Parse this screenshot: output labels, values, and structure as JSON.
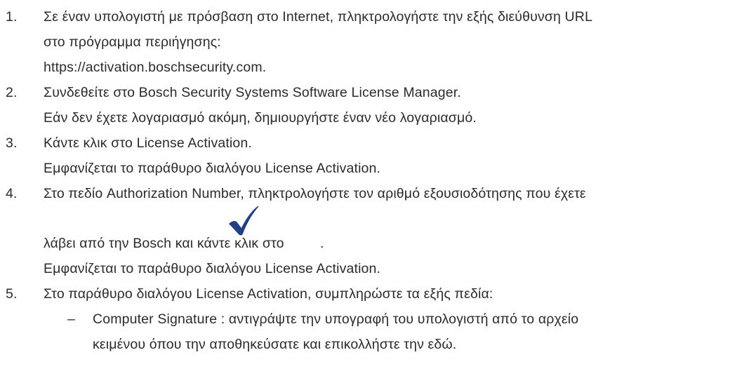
{
  "steps": [
    {
      "number": "1.",
      "lines": [
        "Σε έναν υπολογιστή με πρόσβαση στο Internet, πληκτρολογήστε την εξής διεύθυνση URL",
        "στο πρόγραμμα περιήγησης:",
        "https://activation.boschsecurity.com."
      ]
    },
    {
      "number": "2.",
      "lines": [
        "Συνδεθείτε στο Bosch Security Systems Software License Manager.",
        "Εάν δεν έχετε λογαριασμό ακόμη, δημιουργήστε έναν νέο λογαριασμό."
      ]
    },
    {
      "number": "3.",
      "lines": [
        "Κάντε κλικ στο License Activation.",
        "Εμφανίζεται το παράθυρο διαλόγου License Activation."
      ]
    },
    {
      "number": "4.",
      "lines": [
        "Στο πεδίο Authorization Number, πληκτρολογήστε τον αριθμό εξουσιοδότησης που έχετε",
        "λάβει από την Bosch και κάντε κλικ στο",
        ".",
        "Εμφανίζεται το παράθυρο διαλόγου License Activation."
      ],
      "icon": "checkmark-icon"
    },
    {
      "number": "5.",
      "lines": [
        "Στο παράθυρο διαλόγου License Activation, συμπληρώστε τα εξής πεδία:"
      ],
      "subitems": [
        {
          "marker": "–",
          "lines": [
            "Computer Signature : αντιγράψτε την υπογραφή του υπολογιστή από το αρχείο",
            "κειμένου όπου την αποθηκεύσατε και επικολλήστε την εδώ."
          ]
        }
      ]
    }
  ],
  "colors": {
    "text": "#2b2b2b",
    "checkmark": "#1f3f86"
  }
}
